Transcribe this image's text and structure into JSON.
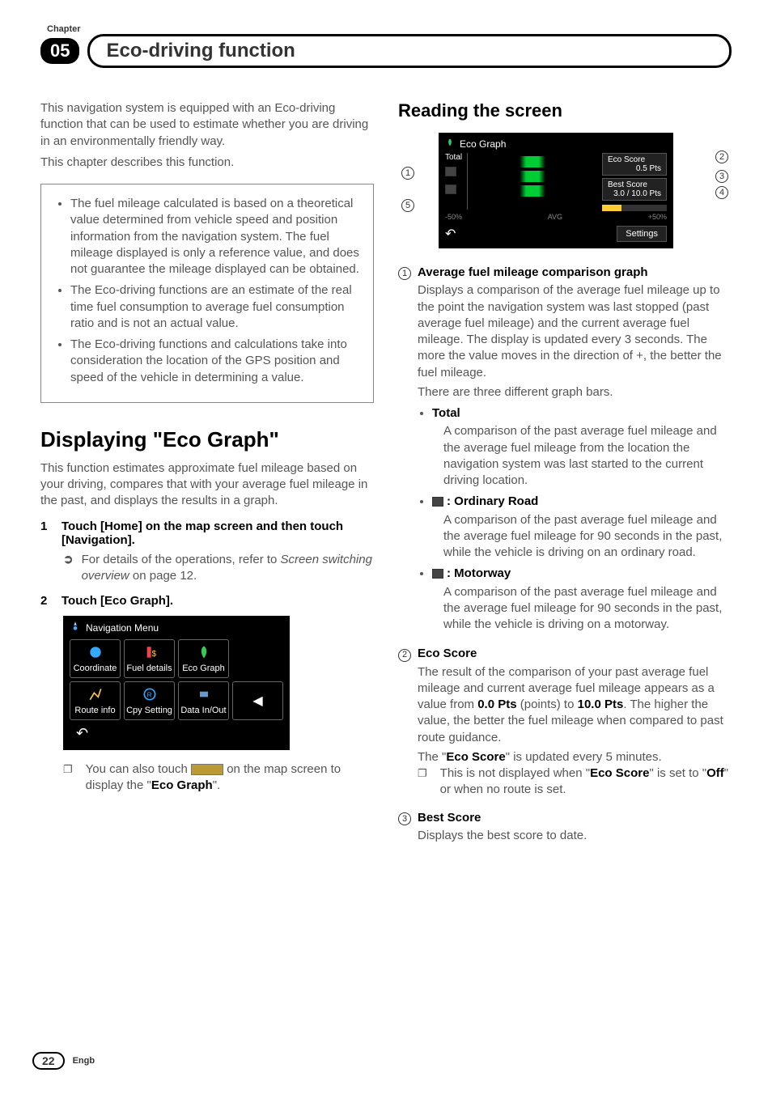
{
  "header": {
    "chapter_label": "Chapter",
    "chapter_num": "05",
    "title": "Eco-driving function"
  },
  "left": {
    "intro_p1": "This navigation system is equipped with an Eco-driving function that can be used to estimate whether you are driving in an environmentally friendly way.",
    "intro_p2": "This chapter describes this function.",
    "note1": "The fuel mileage calculated is based on a theoretical value determined from vehicle speed and position information from the navigation system. The fuel mileage displayed is only a reference value, and does not guarantee the mileage displayed can be obtained.",
    "note2": "The Eco-driving functions are an estimate of the real time fuel consumption to average fuel consumption ratio and is not an actual value.",
    "note3": "The Eco-driving functions and calculations take into consideration the location of the GPS position and speed of the vehicle in determining a value.",
    "h2_a": "Displaying ",
    "h2_b": "\"Eco Graph\"",
    "desc": "This function estimates approximate fuel mileage based on your driving, compares that with your average fuel mileage in the past, and displays the results in a graph.",
    "step1": "Touch [Home] on the map screen and then touch [Navigation].",
    "step1_sub_a": "For details of the operations, refer to ",
    "step1_sub_b": "Screen switching overview",
    "step1_sub_c": " on page 12.",
    "step2": "Touch [Eco Graph].",
    "nav_menu": {
      "title": "Navigation Menu",
      "items": [
        "Coordinate",
        "Fuel details",
        "Eco Graph",
        "Route info",
        "Cpy Setting",
        "Data In/Out"
      ],
      "back_arrow": "◀"
    },
    "touch_note_a": "You can also touch ",
    "touch_note_b": " on the map screen to display the  \"",
    "touch_note_c": "Eco Graph",
    "touch_note_d": "\"."
  },
  "right": {
    "h3": "Reading the screen",
    "eco_graph_ui": {
      "title": "Eco Graph",
      "total": "Total",
      "eco_score_label": "Eco Score",
      "eco_score_value": "0.5 Pts",
      "best_score_label": "Best Score",
      "best_score_value": "3.0 / 10.0 Pts",
      "scale_left": "-50%",
      "scale_mid": "AVG",
      "scale_right": "+50%",
      "settings": "Settings"
    },
    "callouts": [
      "1",
      "2",
      "3",
      "4",
      "5"
    ],
    "items": {
      "i1": {
        "title": "Average fuel mileage comparison graph",
        "body": "Displays a comparison of the average fuel mileage up to the point the navigation system was last stopped (past average fuel mileage) and the current average fuel mileage. The display is updated every 3 seconds. The more the value moves in the direction of +, the better the fuel mileage.",
        "tail": "There are three different graph bars.",
        "sub": {
          "total_t": "Total",
          "total_b": "A comparison of the past average fuel mileage and the average fuel mileage from the location the navigation system was last started to the current driving location.",
          "ord_t": ": Ordinary Road",
          "ord_b": "A comparison of the past average fuel mileage and the average fuel mileage for 90 seconds in the past, while the vehicle is driving on an ordinary road.",
          "mot_t": ": Motorway",
          "mot_b": "A comparison of the past average fuel mileage and the average fuel mileage for 90 seconds in the past, while the vehicle is driving on a motorway."
        }
      },
      "i2": {
        "title": "Eco Score",
        "body_a": "The result of the comparison of your past average fuel mileage and current average fuel mileage appears as a value from ",
        "body_b": "0.0 Pts",
        "body_c": " (points) to ",
        "body_d": "10.0 Pts",
        "body_e": ". The higher the value, the better the fuel mileage when compared to past route guidance.",
        "tail_a": "The \"",
        "tail_b": "Eco Score",
        "tail_c": "\" is updated every 5 minutes.",
        "note_a": "This is not displayed when \"",
        "note_b": "Eco Score",
        "note_c": "\" is set to \"",
        "note_d": "Off",
        "note_e": "\" or when no route is set."
      },
      "i3": {
        "title": "Best Score",
        "body": "Displays the best score to date."
      }
    }
  },
  "chart_data": {
    "type": "bar",
    "title": "Eco Graph",
    "xlabel": "",
    "ylabel": "",
    "x_scale": [
      "-50%",
      "AVG",
      "+50%"
    ],
    "series": [
      {
        "name": "Total",
        "values": [
          0
        ]
      },
      {
        "name": "Ordinary Road",
        "values": [
          0
        ]
      },
      {
        "name": "Motorway",
        "values": [
          0
        ]
      }
    ],
    "scores": {
      "eco_score": 0.5,
      "best_score": 3.0,
      "best_score_max": 10.0,
      "units": "Pts"
    }
  },
  "footer": {
    "page": "22",
    "lang": "Engb"
  }
}
